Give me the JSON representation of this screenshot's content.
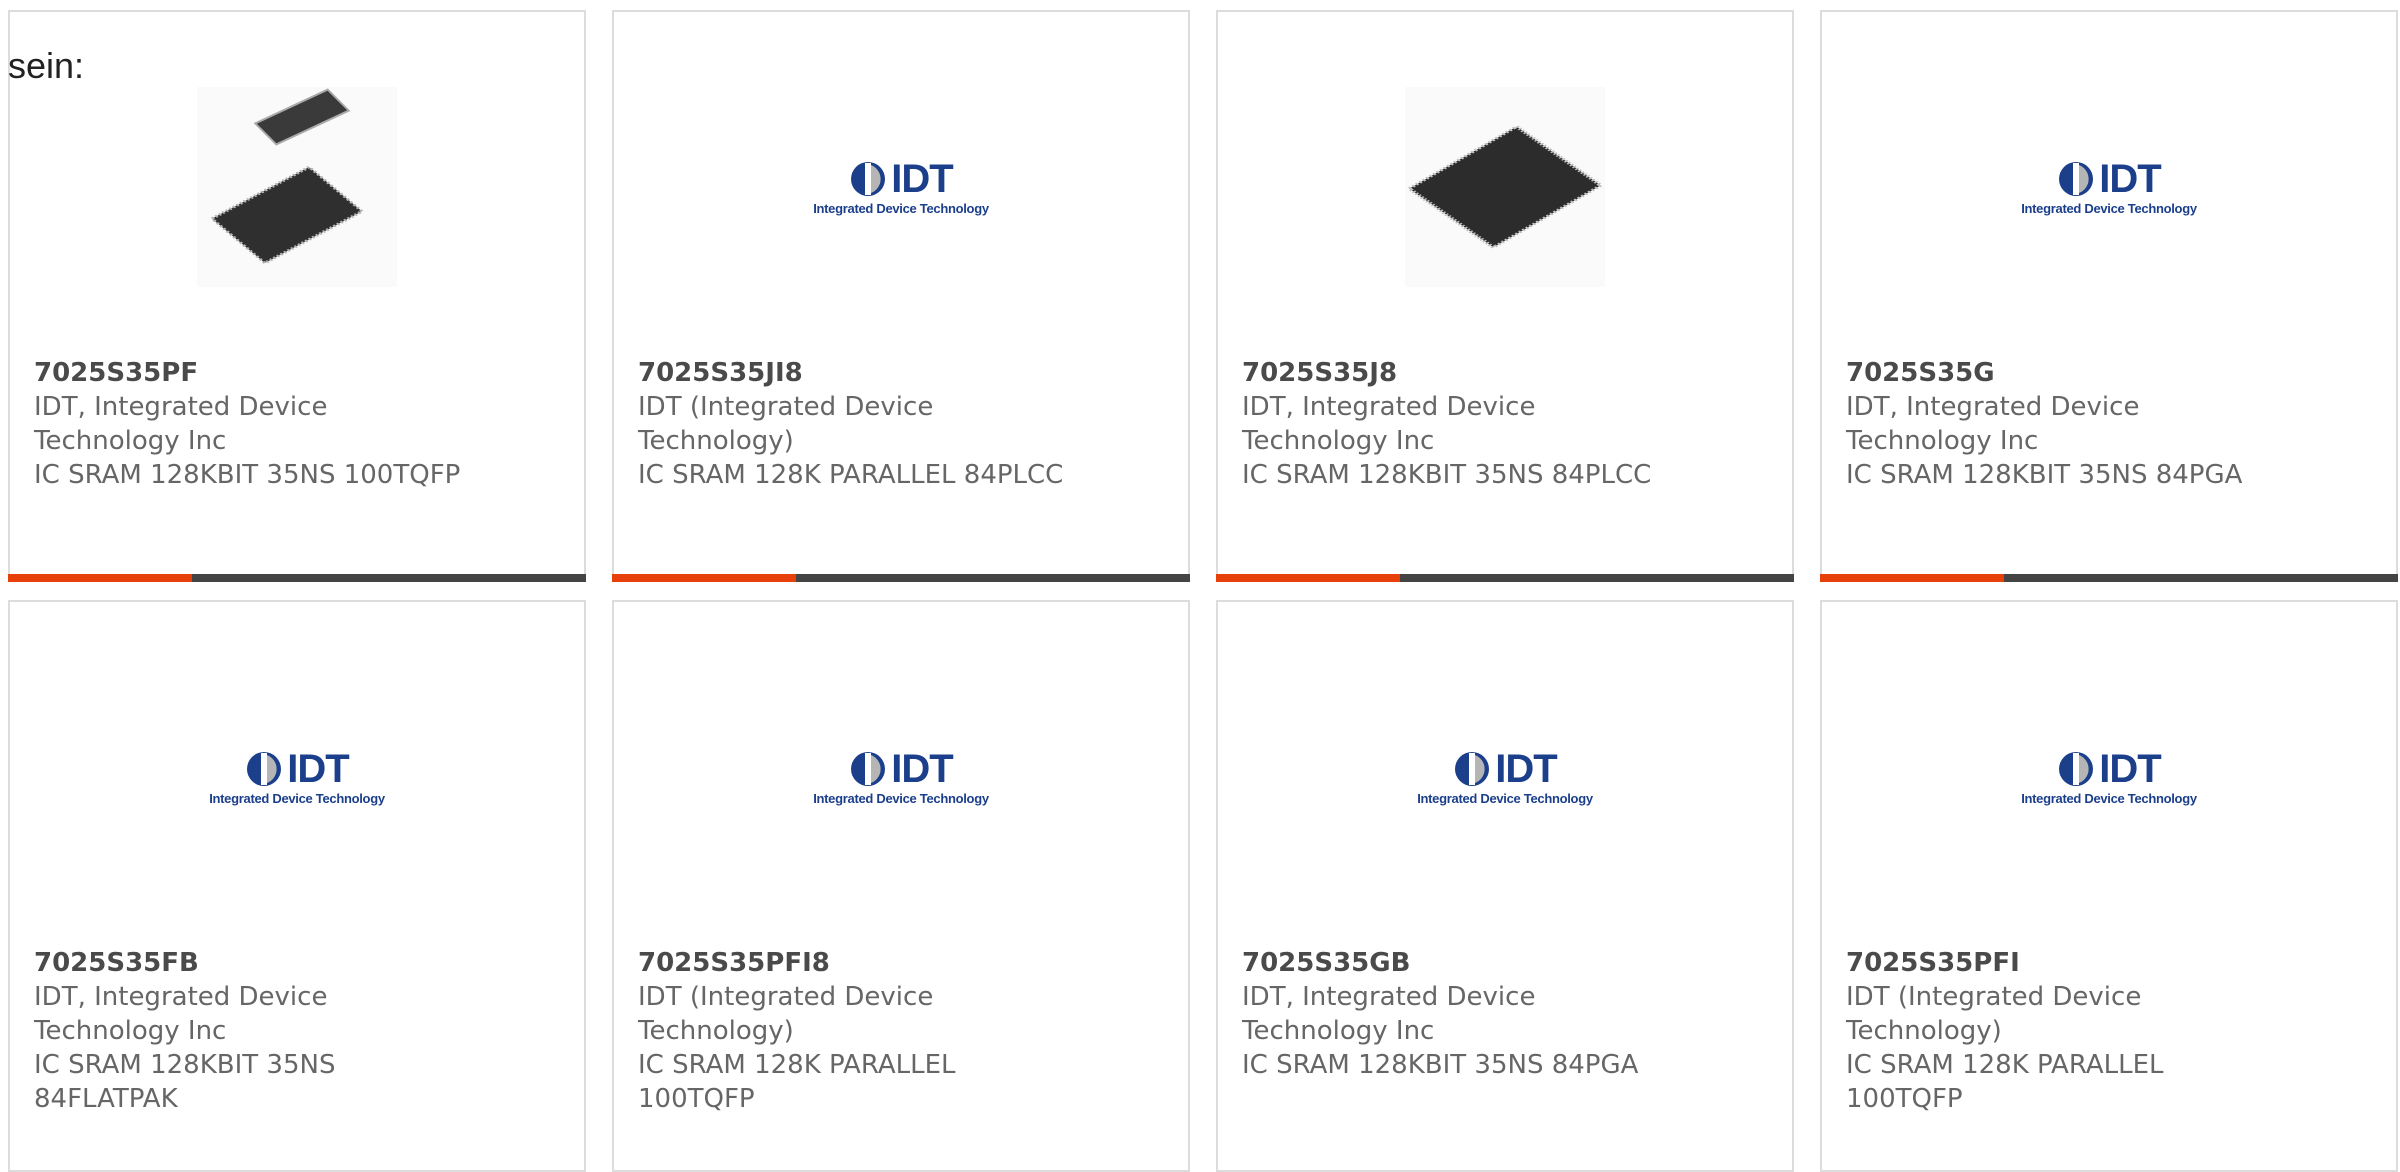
{
  "intro_text": "sein:",
  "logo": {
    "word": "IDT",
    "sub": "Integrated Device Technology"
  },
  "colors": {
    "accent": "#e8400a",
    "bar": "#444444",
    "brand_blue": "#1c3f8c"
  },
  "products": [
    {
      "part": "7025S35PF",
      "mfr_line1": "IDT, Integrated Device",
      "mfr_line2": "Technology Inc",
      "desc_line1": "IC SRAM 128KBIT 35NS 100TQFP",
      "desc_line2": "",
      "image": "two-qfp-chips"
    },
    {
      "part": "7025S35JI8",
      "mfr_line1": "IDT (Integrated Device",
      "mfr_line2": "Technology)",
      "desc_line1": "IC SRAM 128K PARALLEL 84PLCC",
      "desc_line2": "",
      "image": "idt-logo"
    },
    {
      "part": "7025S35J8",
      "mfr_line1": "IDT, Integrated Device",
      "mfr_line2": "Technology Inc",
      "desc_line1": "IC SRAM 128KBIT 35NS 84PLCC",
      "desc_line2": "",
      "image": "plcc-chip"
    },
    {
      "part": "7025S35G",
      "mfr_line1": "IDT, Integrated Device",
      "mfr_line2": "Technology Inc",
      "desc_line1": "IC SRAM 128KBIT 35NS 84PGA",
      "desc_line2": "",
      "image": "idt-logo"
    },
    {
      "part": "7025S35FB",
      "mfr_line1": "IDT, Integrated Device",
      "mfr_line2": "Technology Inc",
      "desc_line1": "IC SRAM 128KBIT 35NS",
      "desc_line2": "84FLATPAK",
      "image": "idt-logo"
    },
    {
      "part": "7025S35PFI8",
      "mfr_line1": "IDT (Integrated Device",
      "mfr_line2": "Technology)",
      "desc_line1": "IC SRAM 128K PARALLEL",
      "desc_line2": "100TQFP",
      "image": "idt-logo"
    },
    {
      "part": "7025S35GB",
      "mfr_line1": "IDT, Integrated Device",
      "mfr_line2": "Technology Inc",
      "desc_line1": "IC SRAM 128KBIT 35NS 84PGA",
      "desc_line2": "",
      "image": "idt-logo"
    },
    {
      "part": "7025S35PFI",
      "mfr_line1": "IDT (Integrated Device",
      "mfr_line2": "Technology)",
      "desc_line1": "IC SRAM 128K PARALLEL",
      "desc_line2": "100TQFP",
      "image": "idt-logo"
    }
  ]
}
